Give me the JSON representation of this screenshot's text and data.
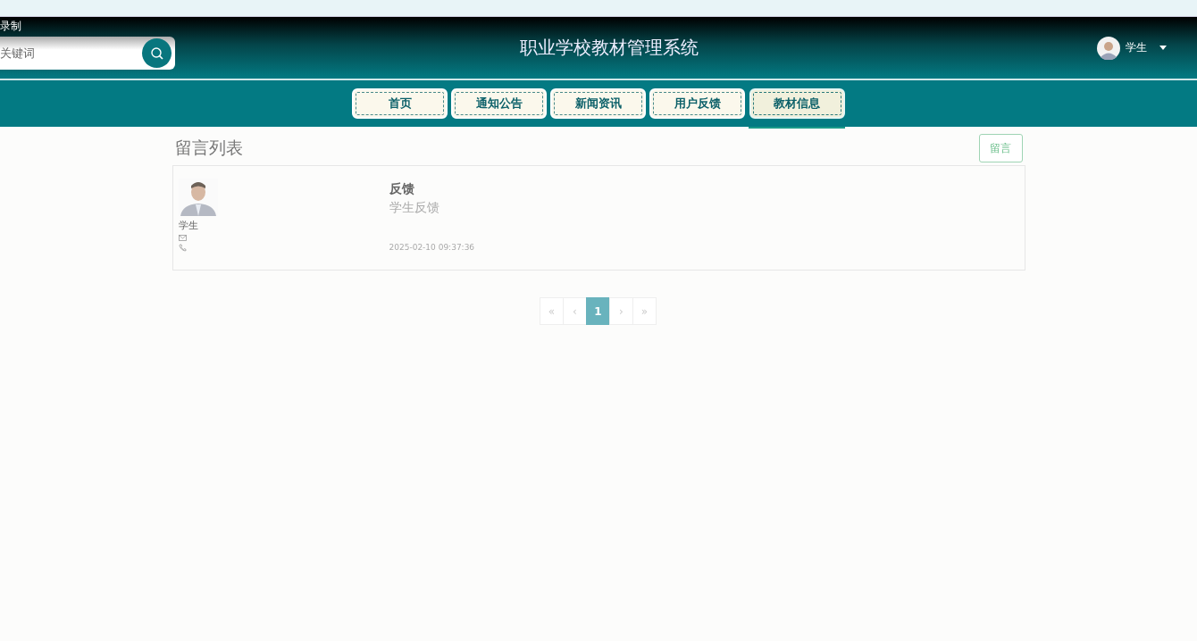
{
  "recording_label": "录制",
  "search": {
    "placeholder": "关键词"
  },
  "site_title": "职业学校教材管理系统",
  "user": {
    "name": "学生"
  },
  "nav": [
    {
      "label": "首页",
      "selected": false
    },
    {
      "label": "通知公告",
      "selected": false
    },
    {
      "label": "新闻资讯",
      "selected": false
    },
    {
      "label": "用户反馈",
      "selected": false
    },
    {
      "label": "教材信息",
      "selected": true
    }
  ],
  "section_title": "留言列表",
  "leave_message_button": "留言",
  "messages": [
    {
      "author": "学生",
      "title": "反馈",
      "content": "学生反馈",
      "time": "2025-02-10 09:37:36"
    }
  ],
  "pagination": [
    {
      "label": "«",
      "selected": false
    },
    {
      "label": "‹",
      "selected": false
    },
    {
      "label": "1",
      "selected": true
    },
    {
      "label": "›",
      "selected": false
    },
    {
      "label": "»",
      "selected": false
    }
  ]
}
